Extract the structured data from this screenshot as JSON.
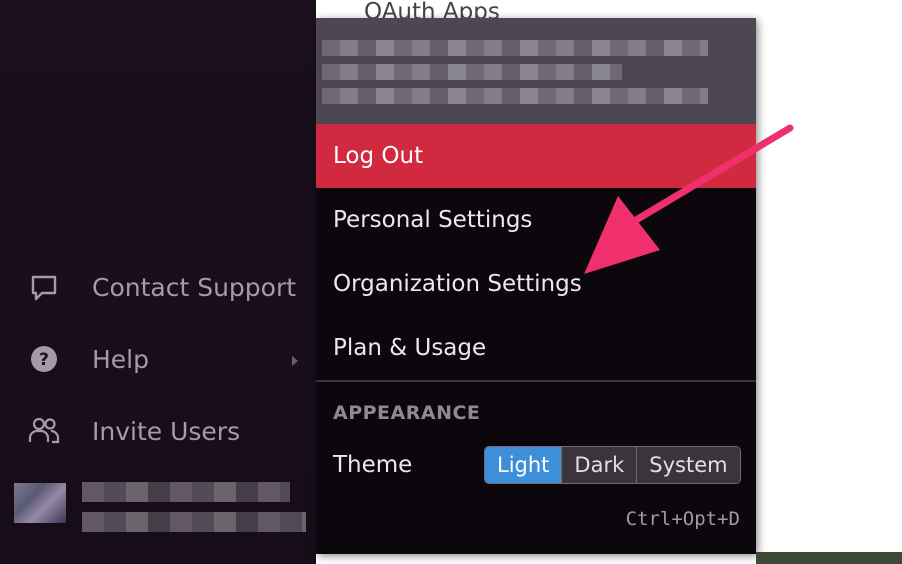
{
  "header": {
    "partial_title": "OAuth Apps"
  },
  "sidebar": {
    "items": [
      {
        "label": "Contact Support",
        "icon": "chat-bubble-icon"
      },
      {
        "label": "Help",
        "icon": "question-circle-icon"
      },
      {
        "label": "Invite Users",
        "icon": "users-icon"
      }
    ]
  },
  "menu": {
    "logout_label": "Log Out",
    "personal_settings_label": "Personal Settings",
    "organization_settings_label": "Organization Settings",
    "plan_usage_label": "Plan & Usage",
    "appearance_heading": "APPEARANCE",
    "theme_label": "Theme",
    "theme_options": [
      "Light",
      "Dark",
      "System"
    ],
    "theme_selected": "Light",
    "shortcut": "Ctrl+Opt+D"
  },
  "colors": {
    "sidebar_bg": "#1b0f1d",
    "menu_bg": "#0c060d",
    "logout_bg": "#d12a40",
    "toggle_active": "#3c8fd8",
    "annotation_arrow": "#f0306c"
  }
}
